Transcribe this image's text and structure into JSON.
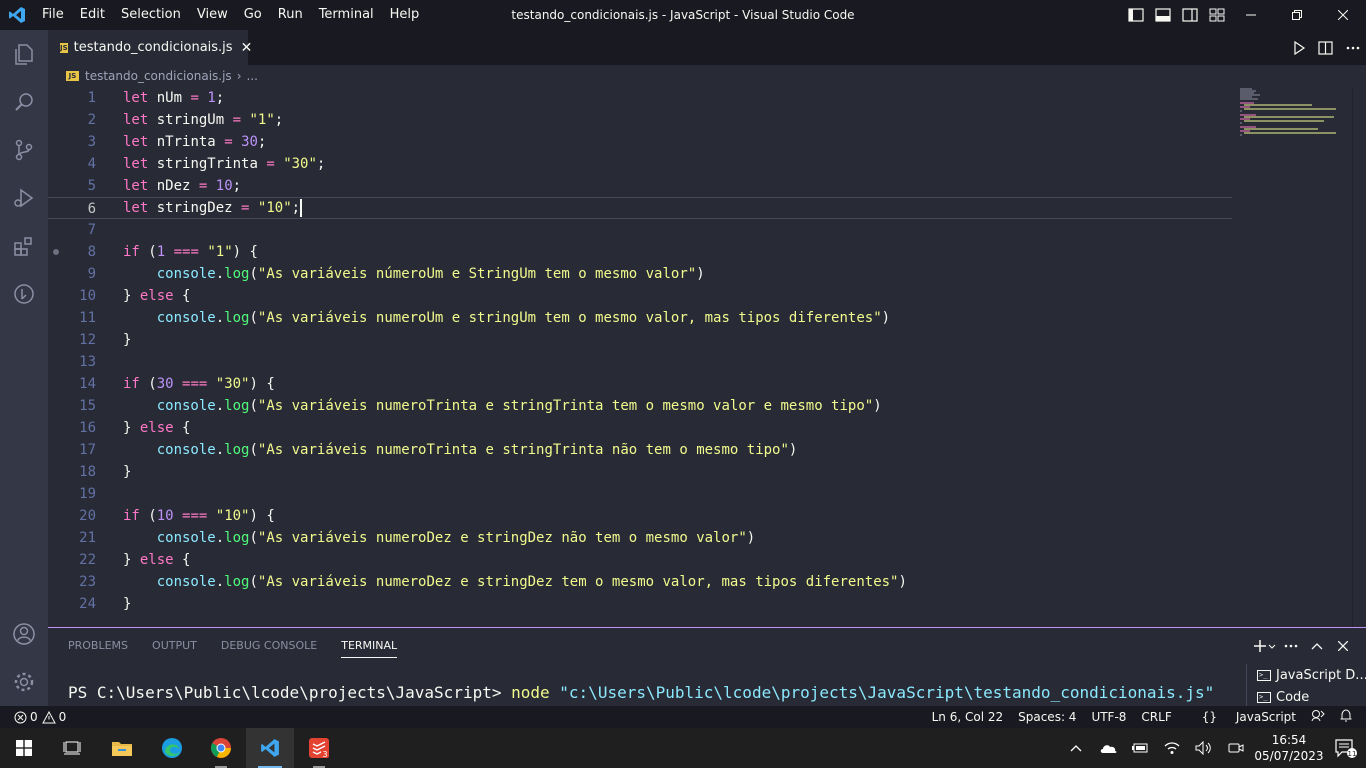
{
  "window": {
    "title": "testando_condicionais.js - JavaScript - Visual Studio Code",
    "menu": [
      "File",
      "Edit",
      "Selection",
      "View",
      "Go",
      "Run",
      "Terminal",
      "Help"
    ]
  },
  "tab": {
    "label": "testando_condicionais.js",
    "close": "✕",
    "badge": "JS"
  },
  "breadcrumb": {
    "file": "testando_condicionais.js",
    "separator": "›",
    "more": "..."
  },
  "editor": {
    "lines": [
      {
        "n": "1"
      },
      {
        "n": "2"
      },
      {
        "n": "3"
      },
      {
        "n": "4"
      },
      {
        "n": "5"
      },
      {
        "n": "6"
      },
      {
        "n": "7"
      },
      {
        "n": "8"
      },
      {
        "n": "9"
      },
      {
        "n": "10"
      },
      {
        "n": "11"
      },
      {
        "n": "12"
      },
      {
        "n": "13"
      },
      {
        "n": "14"
      },
      {
        "n": "15"
      },
      {
        "n": "16"
      },
      {
        "n": "17"
      },
      {
        "n": "18"
      },
      {
        "n": "19"
      },
      {
        "n": "20"
      },
      {
        "n": "21"
      },
      {
        "n": "22"
      },
      {
        "n": "23"
      },
      {
        "n": "24"
      }
    ],
    "tokens": {
      "let": "let",
      "if": "if",
      "else": "else",
      "console": "console",
      "log": "log",
      "nUm": "nUm",
      "stringUm": "stringUm",
      "nTrinta": "nTrinta",
      "stringTrinta": "stringTrinta",
      "nDez": "nDez",
      "stringDez": "stringDez",
      "one": "1",
      "thirty": "30",
      "ten": "10",
      "s_one": "\"1\"",
      "s_thirty": "\"30\"",
      "s_ten": "\"10\"",
      "msg9": "\"As variáveis númeroUm e StringUm tem o mesmo valor\"",
      "msg11": "\"As variáveis numeroUm e stringUm tem o mesmo valor, mas tipos diferentes\"",
      "msg15": "\"As variáveis numeroTrinta e stringTrinta tem o mesmo valor e mesmo tipo\"",
      "msg17": "\"As variáveis numeroTrinta e stringTrinta não tem o mesmo tipo\"",
      "msg21": "\"As variáveis numeroDez e stringDez não tem o mesmo valor\"",
      "msg23": "\"As variáveis numeroDez e stringDez tem o mesmo valor, mas tipos diferentes\""
    }
  },
  "panel": {
    "tabs": [
      "PROBLEMS",
      "OUTPUT",
      "DEBUG CONSOLE",
      "TERMINAL"
    ],
    "active_tab": "TERMINAL",
    "terminal": {
      "prompt": "PS C:\\Users\\Public\\lcode\\projects\\JavaScript> ",
      "command": "node",
      "argument": "\"c:\\Users\\Public\\lcode\\projects\\JavaScript\\testando_condicionais.js\""
    },
    "terminals": [
      "JavaScript D...",
      "Code"
    ]
  },
  "status": {
    "errors": "0",
    "warnings": "0",
    "position": "Ln 6, Col 22",
    "spaces": "Spaces: 4",
    "encoding": "UTF-8",
    "eol": "CRLF",
    "language_braces": "{}",
    "language": "JavaScript"
  },
  "taskbar": {
    "time": "16:54",
    "date": "05/07/2023",
    "notification_count": "11",
    "todoist_badge": "3"
  },
  "colors": {
    "background": "#282a36",
    "titlebar": "#191a21",
    "keyword": "#ff79c6",
    "string": "#f1fa8c",
    "number": "#bd93f9",
    "function": "#50fa7b",
    "object": "#8be9fd"
  }
}
